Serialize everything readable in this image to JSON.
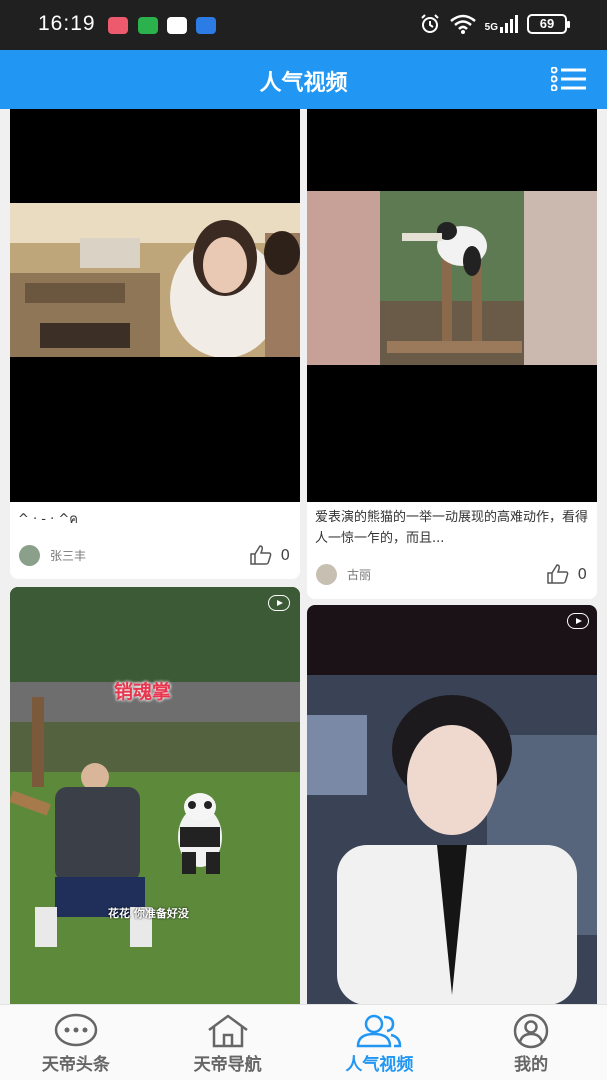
{
  "status_bar": {
    "time": "16:19",
    "network": "5G",
    "battery": "69",
    "app_icons": [
      "mail-app-icon",
      "wechat-icon",
      "qq-icon",
      "cloud-app-icon"
    ],
    "system_icons": [
      "alarm-icon",
      "wifi-icon",
      "signal-icon",
      "battery-icon"
    ]
  },
  "header": {
    "title": "人气视频",
    "background": "#2296f3",
    "menu_icon": "list-menu-icon"
  },
  "videos": [
    {
      "caption": "^   ·   -   ·   ^ค",
      "author": "张三丰",
      "likes": "0"
    },
    {
      "caption": "爱表演的熊猫的一举一动展现的高难动作，看得人一惊一乍的，而且...",
      "author": "古丽",
      "likes": "0"
    },
    {
      "overlay_title": "销魂掌",
      "subtitle": "花花 你准备好没"
    },
    {}
  ],
  "bottom_nav": {
    "items": [
      {
        "label": "天帝头条",
        "icon": "chat-bubble-icon"
      },
      {
        "label": "天帝导航",
        "icon": "home-icon"
      },
      {
        "label": "人气视频",
        "icon": "users-icon",
        "active": true
      },
      {
        "label": "我的",
        "icon": "profile-icon"
      }
    ],
    "active_color": "#2296f3"
  }
}
